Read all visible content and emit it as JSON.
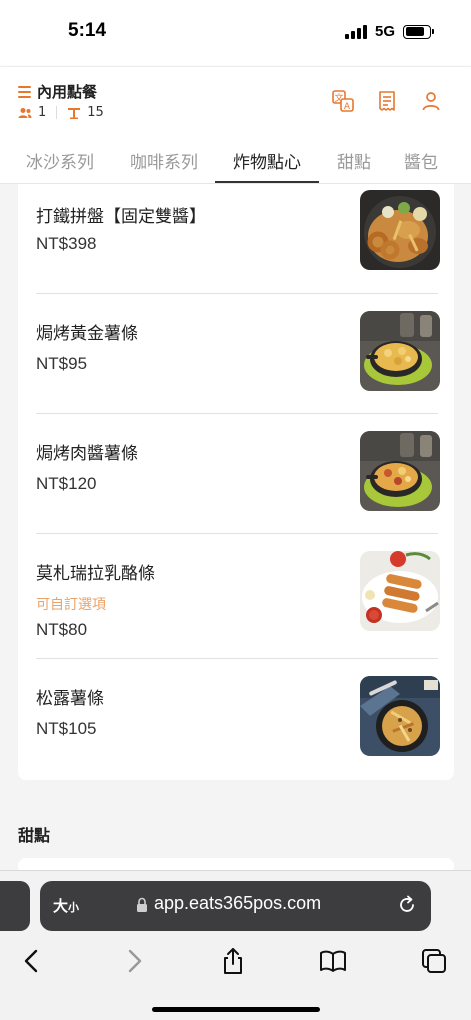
{
  "status_bar": {
    "time": "5:14",
    "network": "5G"
  },
  "header": {
    "title": "內用點餐",
    "guests": "1",
    "table": "15",
    "accent_color": "#e8772e",
    "icons": [
      "translate-icon",
      "receipt-icon",
      "user-icon"
    ]
  },
  "tabs": [
    {
      "label": "冰沙系列",
      "active": false
    },
    {
      "label": "咖啡系列",
      "active": false
    },
    {
      "label": "炸物點心",
      "active": true
    },
    {
      "label": "甜點",
      "active": false
    },
    {
      "label": "醬包",
      "active": false
    }
  ],
  "items": [
    {
      "name": "打鐵拼盤【固定雙醬】",
      "note": "",
      "price": "NT$398"
    },
    {
      "name": "焗烤黃金薯條",
      "note": "",
      "price": "NT$95"
    },
    {
      "name": "焗烤肉醬薯條",
      "note": "",
      "price": "NT$120"
    },
    {
      "name": "莫札瑞拉乳酪條",
      "note": "可自訂選項",
      "price": "NT$80"
    },
    {
      "name": "松露薯條",
      "note": "",
      "price": "NT$105"
    }
  ],
  "next_section": {
    "title": "甜點"
  },
  "safari": {
    "text_size_label": "大",
    "text_size_small": "小",
    "url": "app.eats365pos.com"
  }
}
